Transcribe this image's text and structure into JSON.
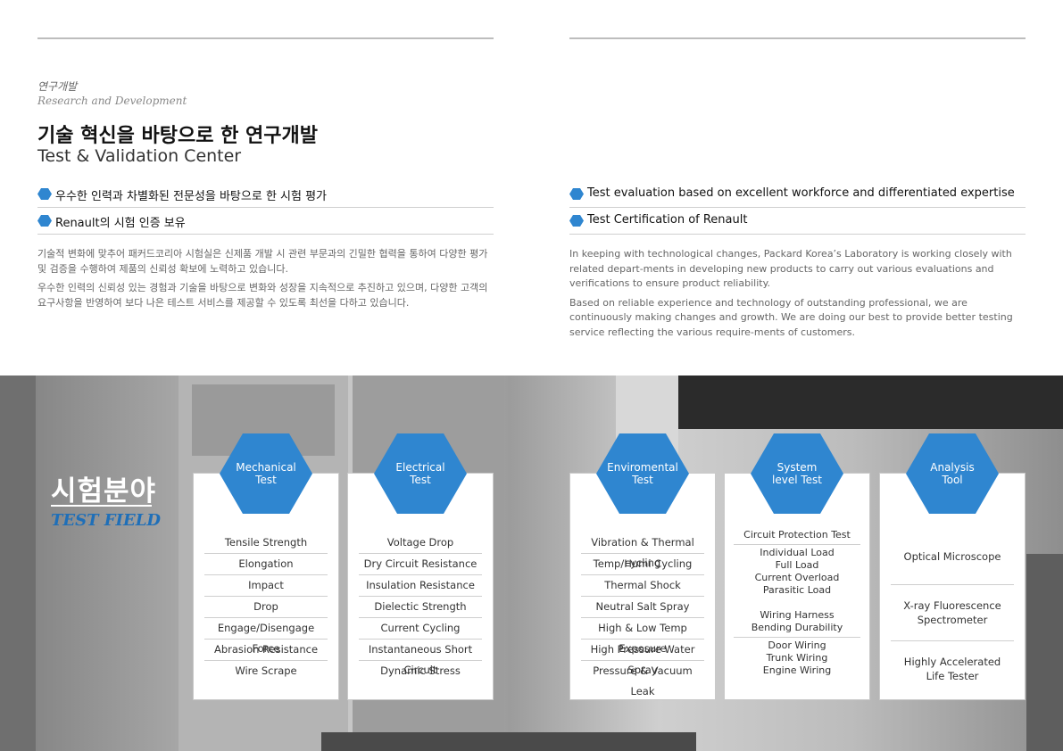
{
  "section": {
    "label_kr": "연구개발",
    "label_en": "Research and Development"
  },
  "title": {
    "kr": "기술 혁신을 바탕으로 한 연구개발",
    "en": "Test & Validation Center"
  },
  "bullets_kr": [
    "우수한 인력과 차별화된 전문성을 바탕으로 한 시험 평가",
    "Renault의 시험 인증 보유"
  ],
  "bullets_en": [
    "Test evaluation based on excellent workforce and differentiated expertise",
    "Test Certification of Renault"
  ],
  "para_kr": [
    "기술적 변화에 맞추어 패커드코리아 시험실은 신제품 개발 시 관련 부문과의 긴밀한 협력을 통하여 다양한 평가 및 검증을 수행하여 제품의 신뢰성 확보에 노력하고 있습니다.",
    "우수한 인력의 신뢰성 있는 경험과 기술을 바탕으로 변화와 성장을 지속적으로 추진하고 있으며, 다양한 고객의 요구사항을 반영하여 보다 나은 테스트 서비스를  제공할 수 있도록 최선을 다하고 있습니다."
  ],
  "para_en": [
    "In keeping with technological changes, Packard Korea’s  Laboratory is working closely with related depart-ments in developing new products to carry out various evaluations and verifications to ensure product reliability.",
    "Based on reliable experience and technology of outstanding professional, we are continuously making changes and growth. We are doing our best to provide better testing service reflecting the various require-ments of customers."
  ],
  "test_field": {
    "kr": "시험분야",
    "en": "TEST FIELD"
  },
  "cards": [
    {
      "title": "Mechanical\nTest",
      "items": [
        "Tensile Strength",
        "Elongation",
        "Impact",
        "Drop",
        "Engage/Disengage Force",
        "Abrasion Resistance",
        "Wire Scrape"
      ]
    },
    {
      "title": "Electrical\nTest",
      "items": [
        "Voltage Drop",
        "Dry Circuit Resistance",
        "Insulation Resistance",
        "Dielectic Strength",
        "Current Cycling",
        "Instantaneous Short Circuit",
        "Dynamic Stress"
      ]
    },
    {
      "title": "Enviromental\nTest",
      "items": [
        "Vibration & Thermal cycling",
        "Temp/Humi Cycling",
        "Thermal Shock",
        "Neutral Salt Spray",
        "High & Low Temp Exposure",
        "High Pressure Water Spray",
        "Pressure & Vacuum Leak"
      ]
    },
    {
      "title": "System\nlevel Test",
      "blocks": [
        "Circuit Protection Test",
        "Individual Load\nFull Load\nCurrent Overload\nParasitic Load\n\nWiring Harness\nBending Durability",
        "Door Wiring\nTrunk Wiring\nEngine Wiring"
      ]
    },
    {
      "title": "Analysis\nTool",
      "tools": [
        "Optical Microscope",
        "X-ray Fluorescence\nSpectrometer",
        "Highly Accelerated\nLife Tester"
      ]
    }
  ],
  "colors": {
    "accent": "#2f86d0",
    "test_field_en": "#1f6fb8"
  }
}
